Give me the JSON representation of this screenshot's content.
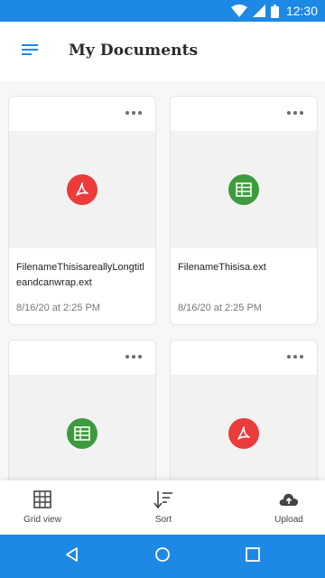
{
  "status_bar": {
    "time": "12:30",
    "icons": [
      "wifi-icon",
      "cell-signal-icon",
      "battery-icon"
    ]
  },
  "app_bar": {
    "menu_icon": "hamburger-menu-icon",
    "title": "My Documents"
  },
  "colors": {
    "primary": "#1e88e5",
    "pdf": "#ec3b3b",
    "spreadsheet": "#3d9b3d"
  },
  "files": [
    {
      "name": "FilenameThisisareallyLongtitleandcanwrap.ext",
      "date": "8/16/20 at 2:25 PM",
      "icon": "pdf-icon"
    },
    {
      "name": "FilenameThisisa.ext",
      "date": "8/16/20 at 2:25 PM",
      "icon": "spreadsheet-icon"
    },
    {
      "name": "",
      "date": "",
      "icon": "spreadsheet-icon"
    },
    {
      "name": "",
      "date": "",
      "icon": "pdf-icon"
    }
  ],
  "toolbar": {
    "grid_view_label": "Grid view",
    "sort_label": "Sort",
    "upload_label": "Upload"
  },
  "nav": {
    "icons": [
      "back-icon",
      "home-icon",
      "recents-icon"
    ]
  }
}
